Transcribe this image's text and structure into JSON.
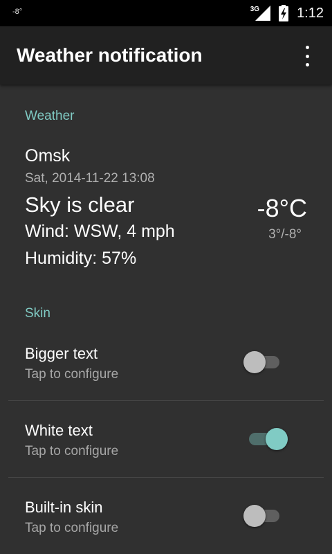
{
  "status_bar": {
    "temperature": "-8°",
    "network_type": "3G",
    "time": "1:12",
    "icons": [
      "signal-icon",
      "battery-charging-icon"
    ]
  },
  "app_bar": {
    "title": "Weather notification",
    "menu_icon": "overflow-menu-icon"
  },
  "weather_section": {
    "header": "Weather",
    "city": "Omsk",
    "datetime": "Sat, 2014-11-22 13:08",
    "condition": "Sky is clear",
    "wind": "Wind: WSW, 4 mph",
    "humidity": "Humidity: 57%",
    "temperature": "-8°C",
    "temp_range": "3°/-8°"
  },
  "skin_section": {
    "header": "Skin",
    "items": [
      {
        "title": "Bigger text",
        "summary": "Tap to configure",
        "enabled": false
      },
      {
        "title": "White text",
        "summary": "Tap to configure",
        "enabled": true
      },
      {
        "title": "Built-in skin",
        "summary": "Tap to configure",
        "enabled": false
      }
    ]
  },
  "colors": {
    "accent": "#80cbc4",
    "app_bar": "#212121",
    "background": "#303030",
    "status_bar": "#000000"
  }
}
